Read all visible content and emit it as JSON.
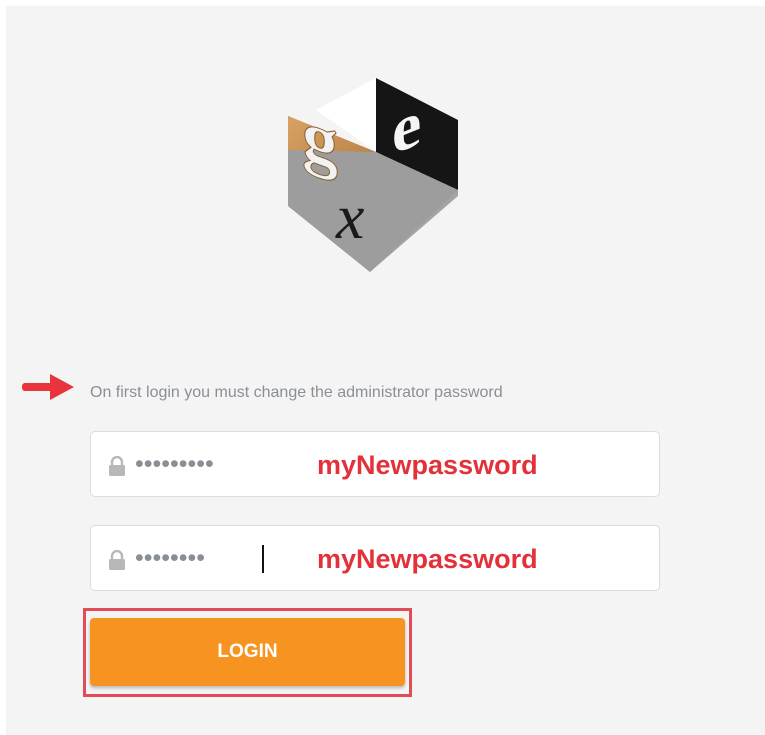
{
  "logo": {
    "letters": [
      "g",
      "e",
      "x"
    ]
  },
  "notice": {
    "text": "On first login you must change the administrator password"
  },
  "password_field": {
    "masked_value": "•••••••••",
    "annotation": "myNewpassword",
    "icon": "lock-icon"
  },
  "confirm_field": {
    "masked_value": "••••••••",
    "annotation": "myNewpassword",
    "icon": "lock-icon"
  },
  "login_button": {
    "label": "LOGIN"
  },
  "colors": {
    "button": "#f79421",
    "annotation": "#e3313a",
    "highlight": "#e04c57",
    "arrow": "#e8343c",
    "notice": "#8a8f96"
  }
}
